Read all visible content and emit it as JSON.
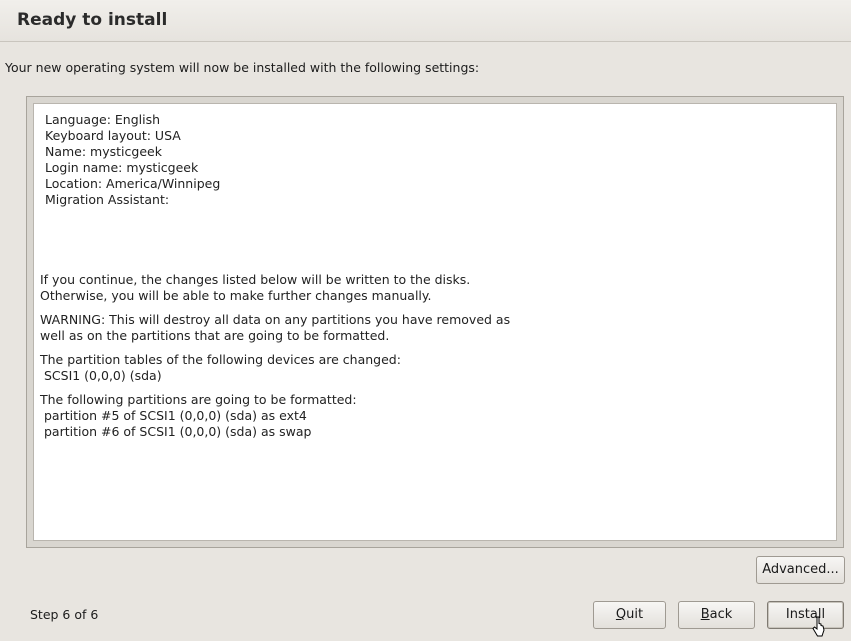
{
  "header": {
    "title": "Ready to install"
  },
  "subtitle": "Your new operating system will now be installed with the following settings:",
  "summary": {
    "settings": [
      "Language: English",
      "Keyboard layout: USA",
      "Name: mysticgeek",
      "Login name: mysticgeek",
      "Location: America/Winnipeg",
      "Migration Assistant:"
    ],
    "notice_1": "If you continue, the changes listed below will be written to the disks.",
    "notice_2": "Otherwise, you will be able to make further changes manually.",
    "warning_1": "WARNING: This will destroy all data on any partitions you have removed as",
    "warning_2": "well as on the partitions that are going to be formatted.",
    "tables_heading": "The partition tables of the following devices are changed:",
    "tables_item": " SCSI1 (0,0,0) (sda)",
    "format_heading": "The following partitions are going to be formatted:",
    "format_items": [
      " partition #5 of SCSI1 (0,0,0) (sda) as ext4",
      " partition #6 of SCSI1 (0,0,0) (sda) as swap"
    ]
  },
  "buttons": {
    "advanced": "Advanced...",
    "quit_mnemonic": "Q",
    "quit_rest": "uit",
    "back_mnemonic": "B",
    "back_rest": "ack",
    "install": "Install"
  },
  "footer": {
    "step": "Step 6 of 6"
  },
  "icons": {
    "cursor": "mouse-pointer-icon"
  }
}
